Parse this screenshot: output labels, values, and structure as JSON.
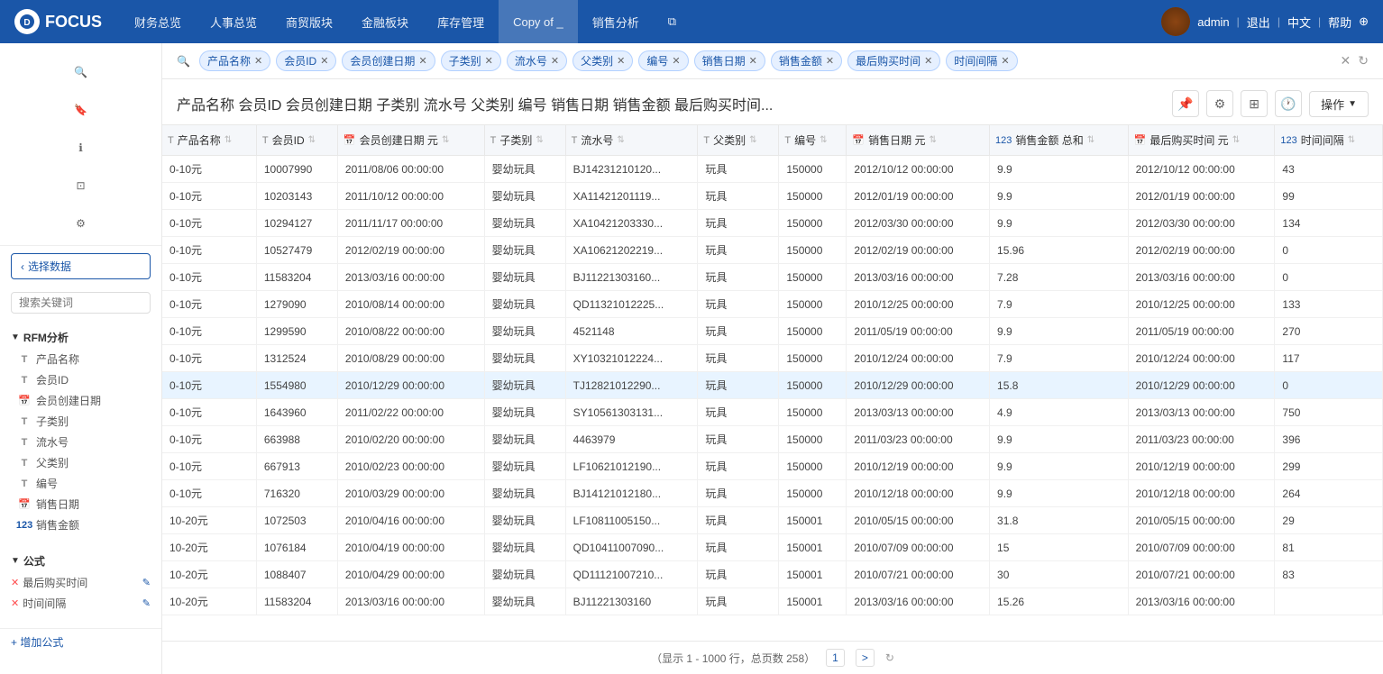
{
  "app": {
    "logo": "FOCUS",
    "nav_items": [
      "财务总览",
      "人事总览",
      "商贸版块",
      "金融板块",
      "库存管理",
      "Copy of _",
      "销售分析"
    ],
    "user": "admin",
    "logout": "退出",
    "lang": "中文",
    "help": "帮助"
  },
  "sidebar": {
    "select_btn": "选择数据",
    "search_placeholder": "搜索关键词",
    "rfm_section": "RFM分析",
    "rfm_fields": [
      {
        "icon": "T",
        "type": "text",
        "label": "产品名称"
      },
      {
        "icon": "T",
        "type": "text",
        "label": "会员ID"
      },
      {
        "icon": "cal",
        "type": "date",
        "label": "会员创建日期"
      },
      {
        "icon": "T",
        "type": "text",
        "label": "子类别"
      },
      {
        "icon": "T",
        "type": "text",
        "label": "流水号"
      },
      {
        "icon": "T",
        "type": "text",
        "label": "父类别"
      },
      {
        "icon": "T",
        "type": "text",
        "label": "编号"
      },
      {
        "icon": "cal",
        "type": "date",
        "label": "销售日期"
      },
      {
        "icon": "123",
        "type": "num",
        "label": "销售金额"
      }
    ],
    "formula_section": "公式",
    "formulas": [
      {
        "label": "最后购买时间"
      },
      {
        "label": "时间间隔"
      }
    ],
    "add_formula": "+ 增加公式"
  },
  "filters": {
    "tags": [
      "产品名称",
      "会员ID",
      "会员创建日期",
      "子类别",
      "流水号",
      "父类别",
      "编号",
      "销售日期",
      "销售金额",
      "最后购买时间",
      "时间间隔"
    ]
  },
  "query": {
    "title": "产品名称 会员ID 会员创建日期 子类别 流水号 父类别 编号 销售日期 销售金额 最后购买时间...",
    "action_btn": "操作"
  },
  "table": {
    "columns": [
      {
        "icon": "T",
        "label": "产品名称",
        "type": "text"
      },
      {
        "icon": "T",
        "label": "会员ID",
        "type": "text"
      },
      {
        "icon": "cal",
        "label": "会员创建日期 元",
        "type": "date"
      },
      {
        "icon": "T",
        "label": "子类别",
        "type": "text"
      },
      {
        "icon": "T",
        "label": "流水号",
        "type": "text"
      },
      {
        "icon": "T",
        "label": "父类别",
        "type": "text"
      },
      {
        "icon": "T",
        "label": "编号",
        "type": "text"
      },
      {
        "icon": "cal",
        "label": "销售日期 元",
        "type": "date"
      },
      {
        "icon": "123",
        "label": "销售金额 总和",
        "type": "num"
      },
      {
        "icon": "cal",
        "label": "最后购买时间 元",
        "type": "date"
      },
      {
        "icon": "123",
        "label": "时间间隔",
        "type": "num"
      }
    ],
    "rows": [
      [
        "0-10元",
        "10007990",
        "2011/08/06 00:00:00",
        "婴幼玩具",
        "BJ14231210120...",
        "玩具",
        "150000",
        "2012/10/12 00:00:00",
        "9.9",
        "2012/10/12 00:00:00",
        "43"
      ],
      [
        "0-10元",
        "10203143",
        "2011/10/12 00:00:00",
        "婴幼玩具",
        "XA11421201119...",
        "玩具",
        "150000",
        "2012/01/19 00:00:00",
        "9.9",
        "2012/01/19 00:00:00",
        "99"
      ],
      [
        "0-10元",
        "10294127",
        "2011/11/17 00:00:00",
        "婴幼玩具",
        "XA10421203330...",
        "玩具",
        "150000",
        "2012/03/30 00:00:00",
        "9.9",
        "2012/03/30 00:00:00",
        "134"
      ],
      [
        "0-10元",
        "10527479",
        "2012/02/19 00:00:00",
        "婴幼玩具",
        "XA10621202219...",
        "玩具",
        "150000",
        "2012/02/19 00:00:00",
        "15.96",
        "2012/02/19 00:00:00",
        "0"
      ],
      [
        "0-10元",
        "11583204",
        "2013/03/16 00:00:00",
        "婴幼玩具",
        "BJ11221303160...",
        "玩具",
        "150000",
        "2013/03/16 00:00:00",
        "7.28",
        "2013/03/16 00:00:00",
        "0"
      ],
      [
        "0-10元",
        "1279090",
        "2010/08/14 00:00:00",
        "婴幼玩具",
        "QD11321012225...",
        "玩具",
        "150000",
        "2010/12/25 00:00:00",
        "7.9",
        "2010/12/25 00:00:00",
        "133"
      ],
      [
        "0-10元",
        "1299590",
        "2010/08/22 00:00:00",
        "婴幼玩具",
        "4521148",
        "玩具",
        "150000",
        "2011/05/19 00:00:00",
        "9.9",
        "2011/05/19 00:00:00",
        "270"
      ],
      [
        "0-10元",
        "1312524",
        "2010/08/29 00:00:00",
        "婴幼玩具",
        "XY10321012224...",
        "玩具",
        "150000",
        "2010/12/24 00:00:00",
        "7.9",
        "2010/12/24 00:00:00",
        "117"
      ],
      [
        "0-10元",
        "1554980",
        "2010/12/29 00:00:00",
        "婴幼玩具",
        "TJ12821012290...",
        "玩具",
        "150000",
        "2010/12/29 00:00:00",
        "15.8",
        "2010/12/29 00:00:00",
        "0"
      ],
      [
        "0-10元",
        "1643960",
        "2011/02/22 00:00:00",
        "婴幼玩具",
        "SY10561303131...",
        "玩具",
        "150000",
        "2013/03/13 00:00:00",
        "4.9",
        "2013/03/13 00:00:00",
        "750"
      ],
      [
        "0-10元",
        "663988",
        "2010/02/20 00:00:00",
        "婴幼玩具",
        "4463979",
        "玩具",
        "150000",
        "2011/03/23 00:00:00",
        "9.9",
        "2011/03/23 00:00:00",
        "396"
      ],
      [
        "0-10元",
        "667913",
        "2010/02/23 00:00:00",
        "婴幼玩具",
        "LF10621012190...",
        "玩具",
        "150000",
        "2010/12/19 00:00:00",
        "9.9",
        "2010/12/19 00:00:00",
        "299"
      ],
      [
        "0-10元",
        "716320",
        "2010/03/29 00:00:00",
        "婴幼玩具",
        "BJ14121012180...",
        "玩具",
        "150000",
        "2010/12/18 00:00:00",
        "9.9",
        "2010/12/18 00:00:00",
        "264"
      ],
      [
        "10-20元",
        "1072503",
        "2010/04/16 00:00:00",
        "婴幼玩具",
        "LF10811005150...",
        "玩具",
        "150001",
        "2010/05/15 00:00:00",
        "31.8",
        "2010/05/15 00:00:00",
        "29"
      ],
      [
        "10-20元",
        "1076184",
        "2010/04/19 00:00:00",
        "婴幼玩具",
        "QD10411007090...",
        "玩具",
        "150001",
        "2010/07/09 00:00:00",
        "15",
        "2010/07/09 00:00:00",
        "81"
      ],
      [
        "10-20元",
        "1088407",
        "2010/04/29 00:00:00",
        "婴幼玩具",
        "QD11121007210...",
        "玩具",
        "150001",
        "2010/07/21 00:00:00",
        "30",
        "2010/07/21 00:00:00",
        "83"
      ],
      [
        "10-20元",
        "11583204",
        "2013/03/16 00:00:00",
        "婴幼玩具",
        "BJ11221303160",
        "玩具",
        "150001",
        "2013/03/16 00:00:00",
        "15.26",
        "2013/03/16 00:00:00",
        ""
      ]
    ]
  },
  "pagination": {
    "info": "（显示 1 - 1000 行，总页数 258）",
    "current": "1",
    "next": ">"
  },
  "icons": {
    "search": "🔍",
    "pin": "📌",
    "gear": "⚙",
    "table": "⊞",
    "clock": "🕐",
    "chevron_down": "▼",
    "refresh": "↻",
    "close": "✕"
  }
}
